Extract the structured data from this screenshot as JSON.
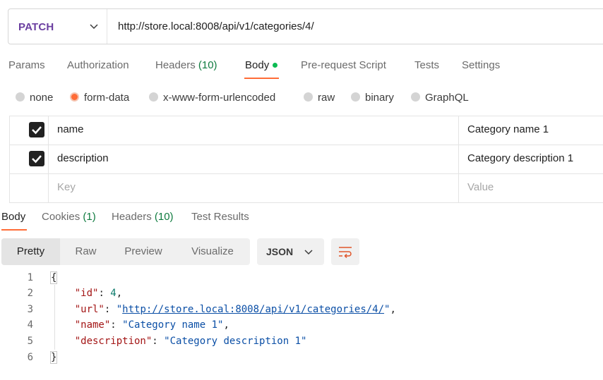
{
  "request": {
    "method": "PATCH",
    "url": "http://store.local:8008/api/v1/categories/4/"
  },
  "request_tabs": [
    {
      "label": "Params"
    },
    {
      "label": "Authorization"
    },
    {
      "label": "Headers",
      "count": "(10)"
    },
    {
      "label": "Body"
    },
    {
      "label": "Pre-request Script"
    },
    {
      "label": "Tests"
    },
    {
      "label": "Settings"
    }
  ],
  "body_types": [
    "none",
    "form-data",
    "x-www-form-urlencoded",
    "raw",
    "binary",
    "GraphQL"
  ],
  "body_type_selected": "form-data",
  "params": {
    "rows": [
      {
        "key": "name",
        "value": "Category name 1",
        "checked": true
      },
      {
        "key": "description",
        "value": "Category description 1",
        "checked": true
      }
    ],
    "key_placeholder": "Key",
    "value_placeholder": "Value"
  },
  "response_tabs": [
    {
      "label": "Body"
    },
    {
      "label": "Cookies",
      "count": "(1)"
    },
    {
      "label": "Headers",
      "count": "(10)"
    },
    {
      "label": "Test Results"
    }
  ],
  "view_modes": [
    "Pretty",
    "Raw",
    "Preview",
    "Visualize"
  ],
  "format": "JSON",
  "code": {
    "line_numbers": [
      "1",
      "2",
      "3",
      "4",
      "5",
      "6"
    ],
    "open_brace": "{",
    "close_brace": "}",
    "fields": [
      {
        "key": "\"id\"",
        "value": "4"
      },
      {
        "key": "\"url\"",
        "value": "http://store.local:8008/api/v1/categories/4/"
      },
      {
        "key": "\"name\"",
        "value": "\"Category name 1\""
      },
      {
        "key": "\"description\"",
        "value": "\"Category description 1\""
      }
    ]
  },
  "colors": {
    "accent": "#ff6c37",
    "method": "#6b3fa0",
    "count": "#0f7b3f",
    "body_dot": "#0cbb52"
  }
}
